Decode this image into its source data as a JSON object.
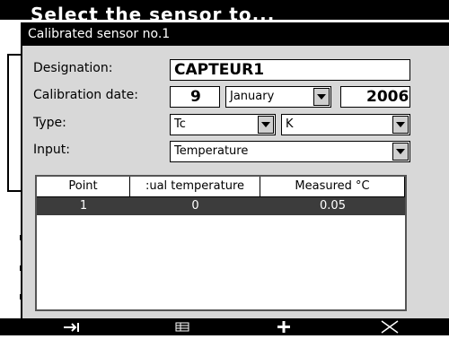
{
  "background": {
    "title": "Select the sensor to..."
  },
  "dialog": {
    "title": "Calibrated sensor no.1",
    "designation": {
      "label": "Designation:",
      "value": "CAPTEUR1"
    },
    "calibration_date": {
      "label": "Calibration date:",
      "day": "9",
      "month": "January",
      "year": "2006"
    },
    "type": {
      "label": "Type:",
      "value": "Tc",
      "subtype": "K"
    },
    "input": {
      "label": "Input:",
      "value": "Temperature"
    },
    "table": {
      "headers": [
        "Point",
        ":ual temperature",
        "Measured °C"
      ],
      "rows": [
        {
          "point": "1",
          "actual": "0",
          "measured": "0.05"
        }
      ]
    }
  },
  "bottom_bar": {
    "icons": [
      "tab-arrow-icon",
      "list-icon",
      "plus-icon",
      "close-icon"
    ]
  }
}
